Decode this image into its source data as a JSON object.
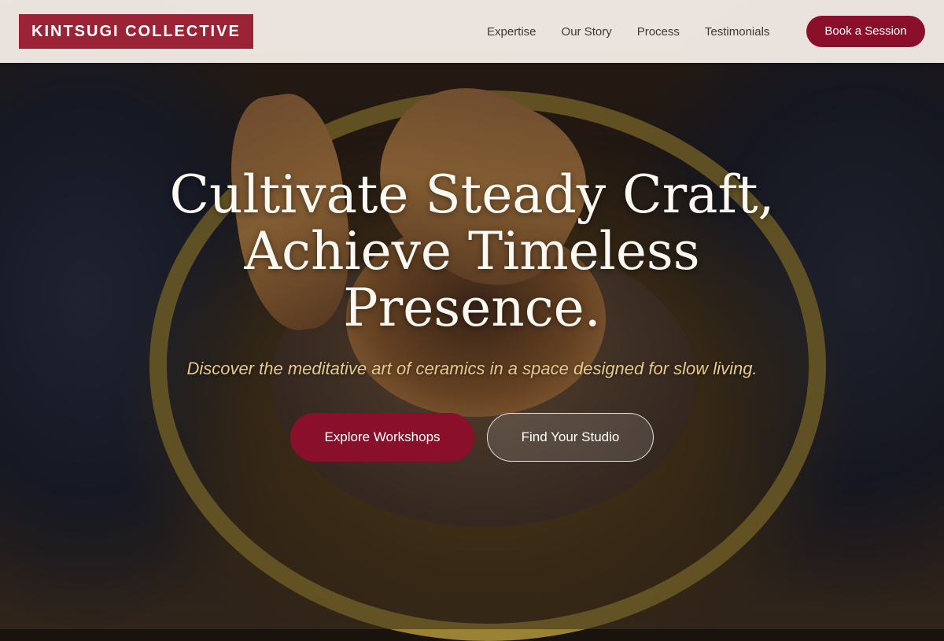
{
  "brand": {
    "name": "KINTSUGI COLLECTIVE",
    "accent_color": "#9b2335"
  },
  "nav": {
    "links": [
      "Expertise",
      "Our Story",
      "Process",
      "Testimonials"
    ],
    "cta_label": "Book a Session",
    "cta_color": "#8a0f2a"
  },
  "hero": {
    "title_lines": [
      "Cultivate Steady Craft,",
      "Achieve Timeless",
      "Presence."
    ],
    "subtitle": "Discover the meditative art of ceramics in a space designed for slow living.",
    "primary_cta": "Explore Workshops",
    "secondary_cta": "Find Your Studio",
    "background_image": "pottery-wheel-hands-photo"
  }
}
